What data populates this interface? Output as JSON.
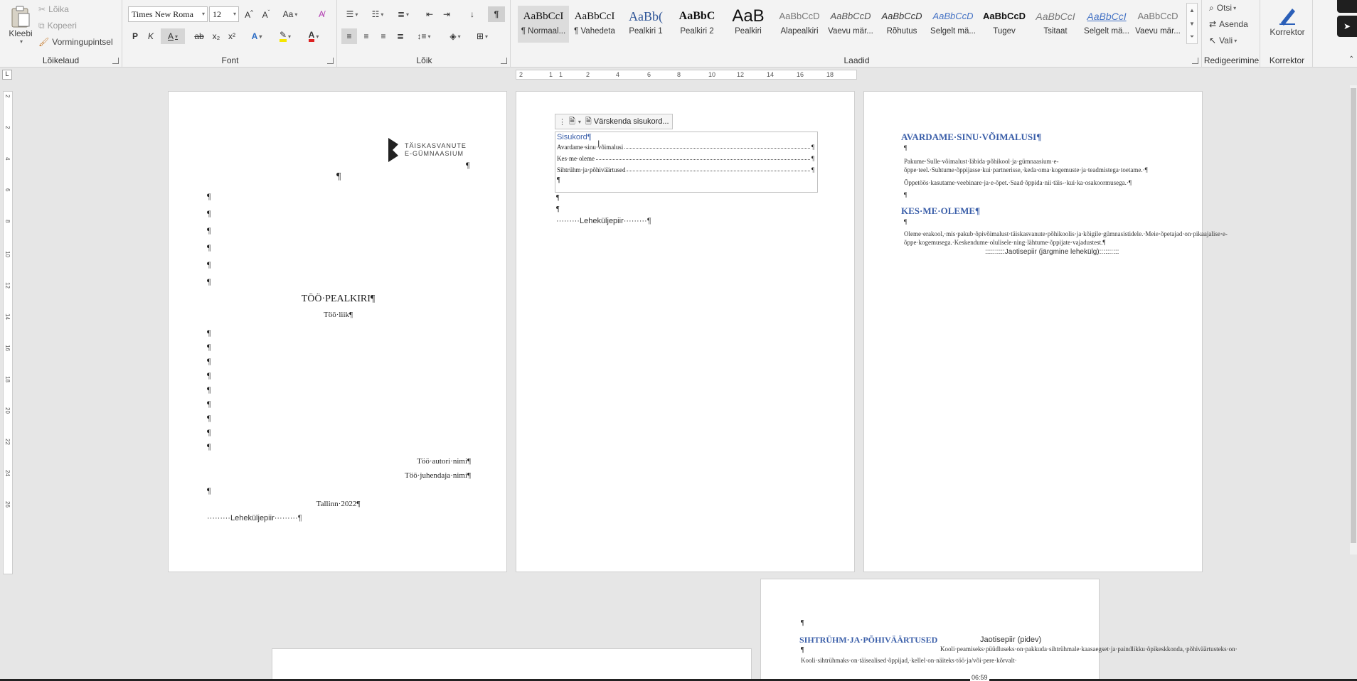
{
  "clipboard": {
    "group_label": "Lõikelaud",
    "paste": "Kleebi",
    "cut": "Lõika",
    "copy": "Kopeeri",
    "format_painter": "Vormingupintsel"
  },
  "font": {
    "group_label": "Font",
    "font_name": "Times New Roma",
    "font_size": "12",
    "bold": "P",
    "italic": "K",
    "underline": "A",
    "strike": "ab",
    "sub": "x₂",
    "sup": "x²",
    "grow": "A^",
    "shrink": "A˅",
    "case": "Aa"
  },
  "paragraph": {
    "group_label": "Lõik",
    "pilcrow": "¶"
  },
  "styles": {
    "group_label": "Laadid",
    "items": [
      {
        "preview": "AaBbCcI",
        "label": "¶ Normaal..."
      },
      {
        "preview": "AaBbCcI",
        "label": "¶ Vahedeta"
      },
      {
        "preview": "AaBb(",
        "label": "Pealkiri 1"
      },
      {
        "preview": "AaBbC",
        "label": "Pealkiri 2"
      },
      {
        "preview": "AaB",
        "label": "Pealkiri"
      },
      {
        "preview": "AaBbCcD",
        "label": "Alapealkiri"
      },
      {
        "preview": "AaBbCcD",
        "label": "Vaevu mär..."
      },
      {
        "preview": "AaBbCcD",
        "label": "Rõhutus"
      },
      {
        "preview": "AaBbCcD",
        "label": "Selgelt mä..."
      },
      {
        "preview": "AaBbCcD",
        "label": "Tugev"
      },
      {
        "preview": "AaBbCcI",
        "label": "Tsitaat"
      },
      {
        "preview": "AaBbCcI",
        "label": "Selgelt mä..."
      },
      {
        "preview": "AaBbCcD",
        "label": "Vaevu mär..."
      }
    ]
  },
  "editing": {
    "group_label": "Redigeerimine",
    "find": "Otsi",
    "replace": "Asenda",
    "select": "Vali"
  },
  "editor": {
    "group_label": "Korrektor",
    "label": "Korrektor"
  },
  "ruler": {
    "h_ticks": [
      "2",
      "1",
      "1",
      "2",
      "4",
      "6",
      "8",
      "10",
      "12",
      "14",
      "16",
      "18"
    ],
    "v_ticks": [
      "2",
      "2",
      "4",
      "6",
      "8",
      "10",
      "12",
      "14",
      "16",
      "18",
      "20",
      "22",
      "24",
      "26"
    ]
  },
  "page1": {
    "logo_line1": "TÄISKASVANUTE",
    "logo_line2": "E-GÜMNAASIUM",
    "title": "TÖÖ·PEALKIRI¶",
    "subtitle": "Töö·liik¶",
    "author": "Töö·autori·nimi¶",
    "supervisor": "Töö·juhendaja·nimi¶",
    "place_year": "Tallinn·2022¶",
    "page_break": "·········Leheküljepiir·········¶",
    "pilcrow": "¶"
  },
  "page2": {
    "toolbar_update": "Värskenda sisukord...",
    "toc_title": "Sisukord¶",
    "toc_items": [
      "Avardame·sinu·võimalusi",
      "Kes·me·oleme",
      "Sihtrühm·ja·põhiväärtused"
    ],
    "toc_page": "¶",
    "page_break": "·········Leheküljepiir·········¶"
  },
  "page3": {
    "heading1": "AVARDAME·SINU·VÕIMALUSI¶",
    "para1": "Pakume·Sulle·võimalust·läbida·põhikool·ja·gümnaasium·e-õppe·teel.·Suhtume·õppijasse·kui·partnerisse,·keda·oma·kogemuste·ja·teadmistega·toetame.·¶",
    "para2": "Õppetöös·kasutame·veebinare·ja·e-õpet.·Saad·õppida·nii·täis-·kui·ka·osakoormusega.·¶",
    "heading2": "KES·ME·OLEME¶",
    "para3": "Oleme·erakool,·mis·pakub·õpivõimalust·täiskasvanute·põhikoolis·ja·kõigile·gümnasistidele.·Meie·õpetajad·on·pikaajalise·e-õppe·kogemusega.·Keskendume·olulisele·ning·lähtume·õppijate·vajadustest.¶",
    "section_break": "::::::::::Jaotisepiir (järgmine lehekülg)::::::::::"
  },
  "page4": {
    "heading": "SIHTRÜHM·JA·PÕHIVÄÄRTUSED",
    "section_break": "Jaotisepiir (pidev)",
    "col1": "Kooli·sihtrühmaks·on·täisealised·õppijad,·kellel·on·näiteks·töö·ja/või·pere·kõrvalt·",
    "col2": "Kooli·peamiseks·püüdluseks·on·pakkuda·sihtrühmale·kaasaegset·ja·paindlikku·õpikeskkonda,·põhiväärtusteks·on·",
    "time": "06:59"
  }
}
